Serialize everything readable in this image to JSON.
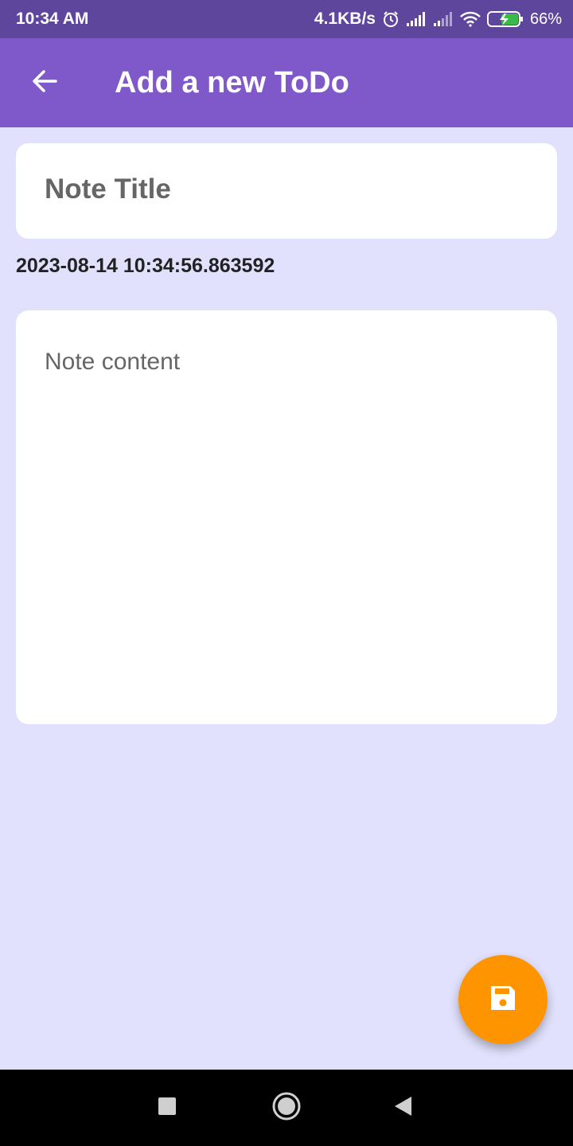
{
  "status_bar": {
    "time": "10:34 AM",
    "network_speed": "4.1KB/s",
    "battery_percent": "66%",
    "icons": [
      "alarm-icon",
      "signal-icon",
      "signal-icon",
      "wifi-icon",
      "battery-charging-icon"
    ]
  },
  "app_bar": {
    "title": "Add a new ToDo",
    "back_icon": "arrow-back-icon"
  },
  "form": {
    "title_placeholder": "Note Title",
    "title_value": "",
    "timestamp": "2023-08-14 10:34:56.863592",
    "content_placeholder": "Note content",
    "content_value": ""
  },
  "fab": {
    "icon": "save-icon"
  },
  "nav": {
    "icons": [
      "recents-square-icon",
      "home-circle-icon",
      "back-triangle-icon"
    ]
  },
  "colors": {
    "status_bar": "#5f469d",
    "app_bar": "#7f58c9",
    "background": "#e1e1fd",
    "card": "#ffffff",
    "fab": "#fe9500",
    "nav_bar": "#000000"
  }
}
